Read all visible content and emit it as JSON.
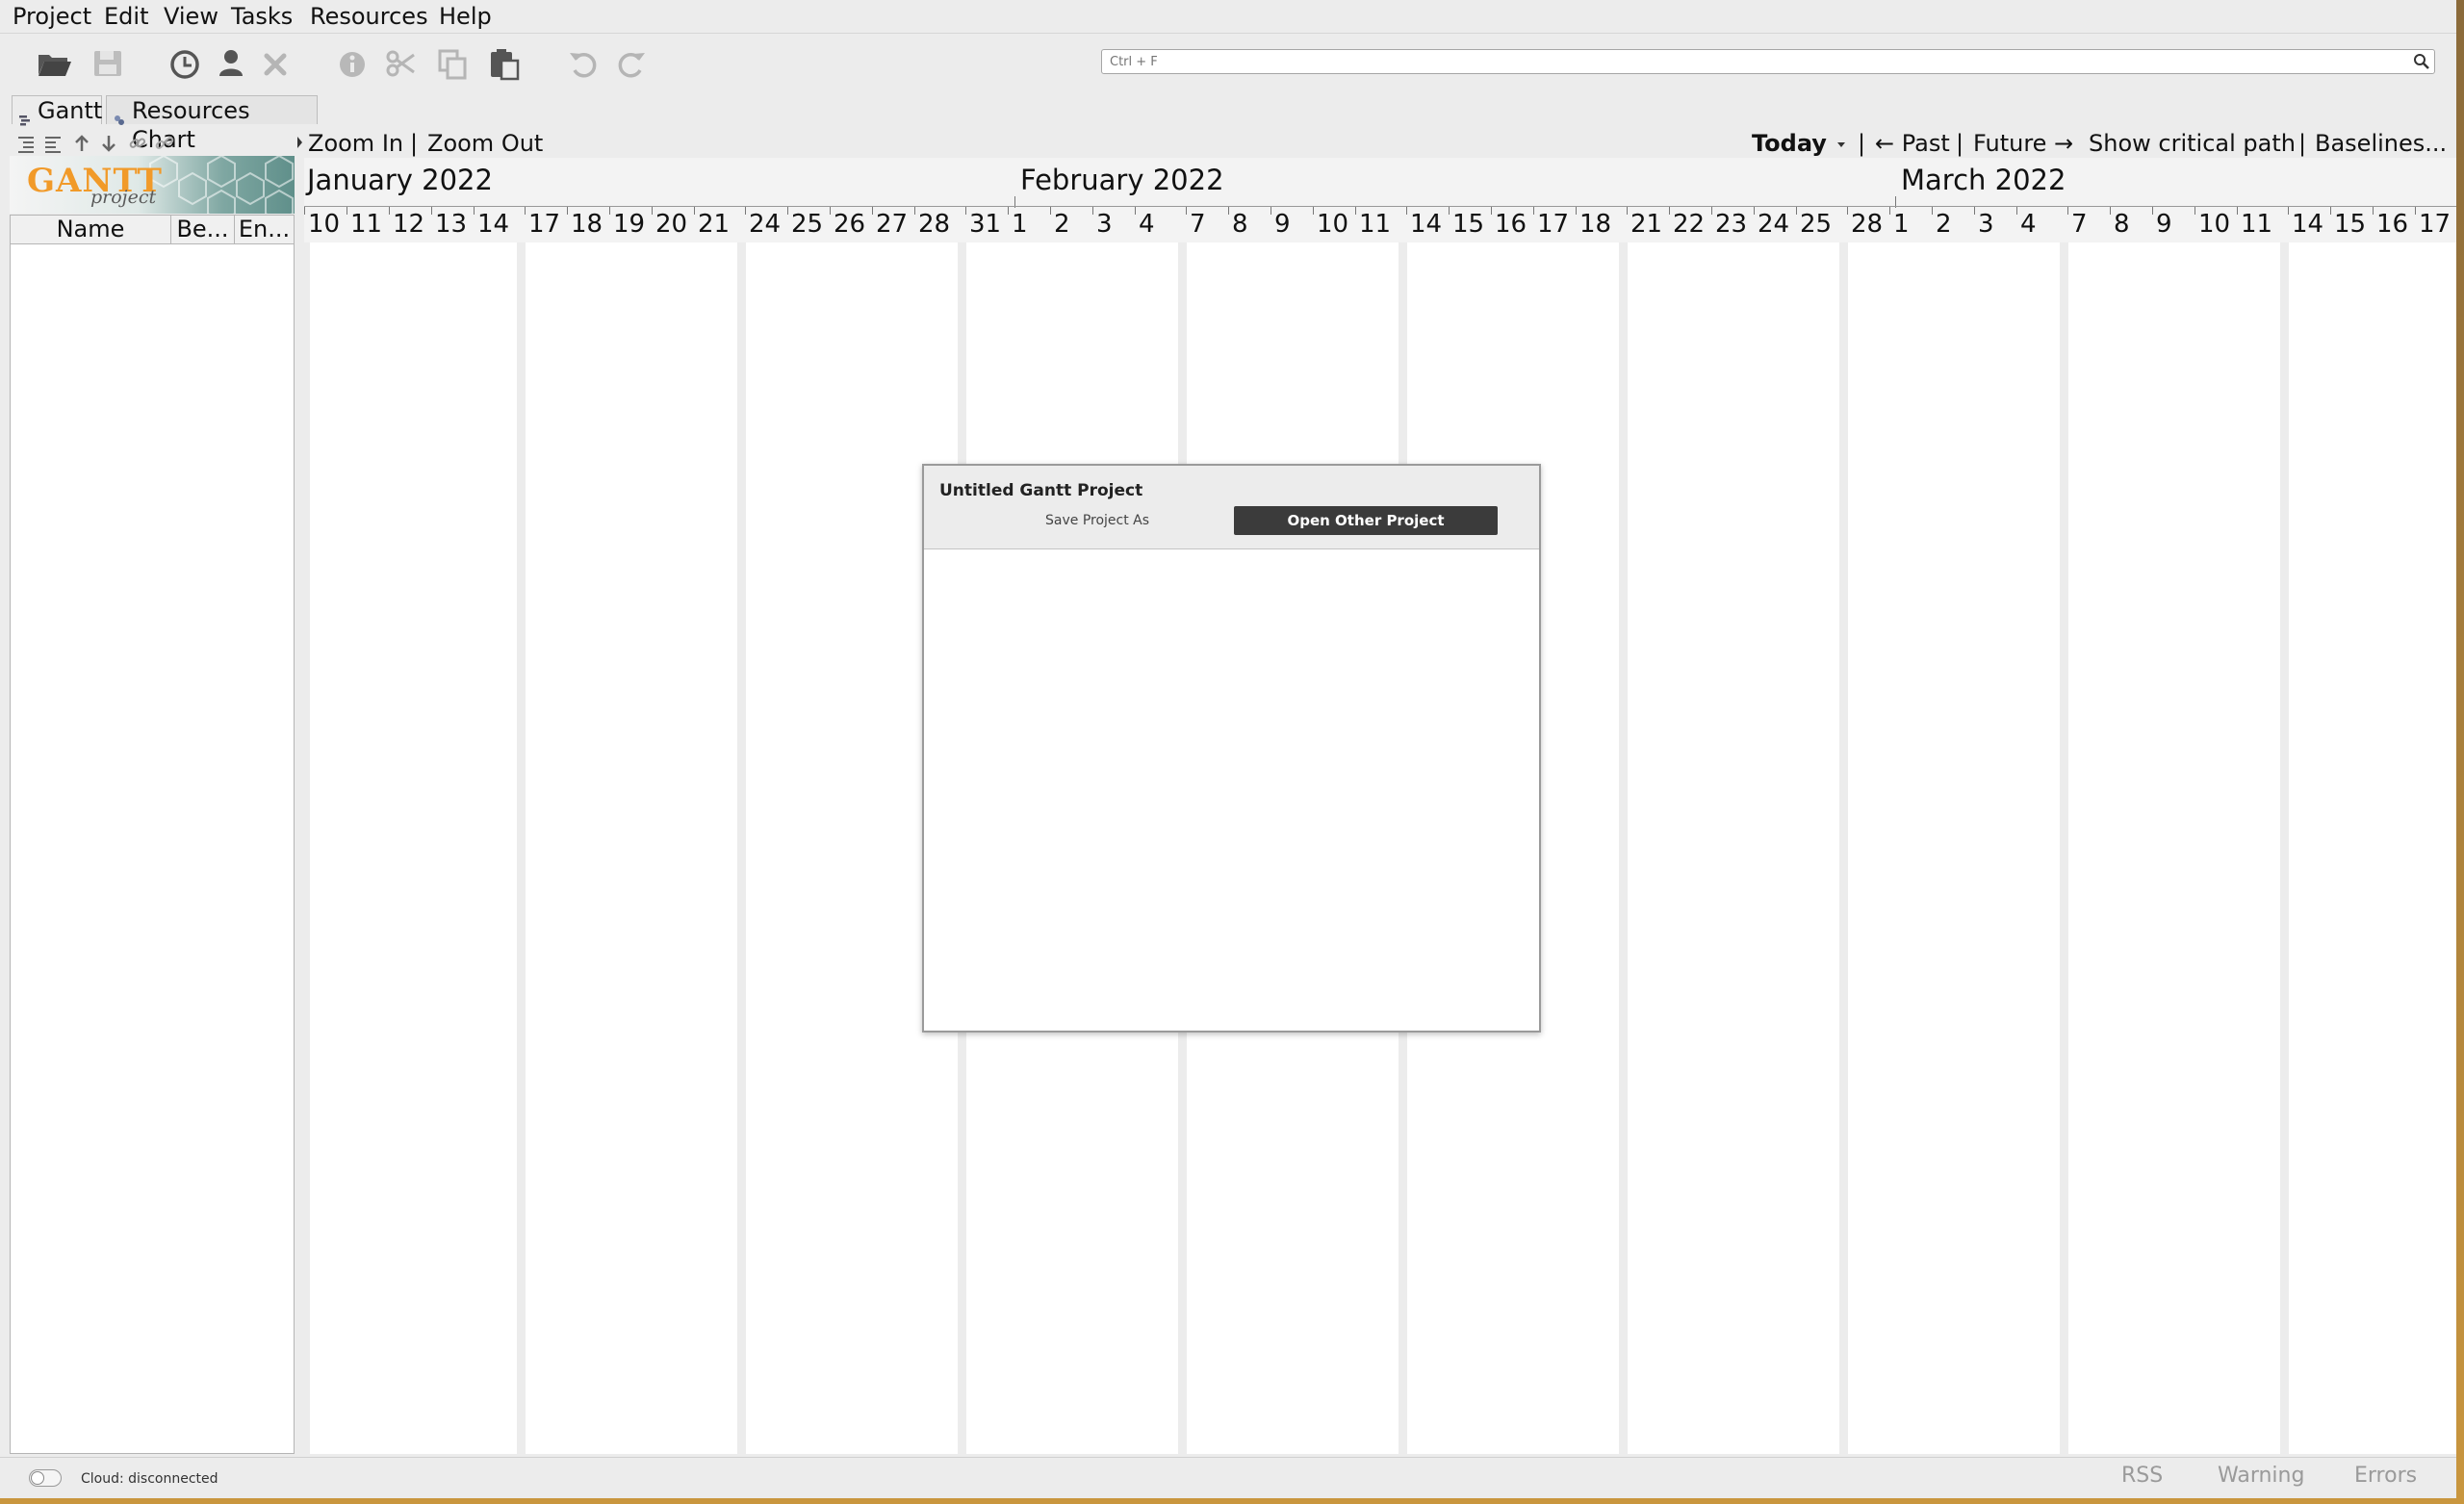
{
  "menu": {
    "items": [
      {
        "label": "Project"
      },
      {
        "label": "Edit"
      },
      {
        "label": "View"
      },
      {
        "label": "Tasks"
      },
      {
        "label": "Resources"
      },
      {
        "label": "Help"
      }
    ]
  },
  "toolbar": {
    "icons": [
      "open-folder-icon",
      "save-icon",
      "history-icon",
      "user-icon",
      "delete-icon",
      "info-icon",
      "cut-icon",
      "copy-icon",
      "paste-icon",
      "undo-icon",
      "redo-icon"
    ],
    "search_placeholder": "Ctrl + F"
  },
  "tabs": [
    {
      "label": "Gantt",
      "active": true
    },
    {
      "label": "Resources Chart",
      "active": false
    }
  ],
  "logo": {
    "text": "GANTT",
    "sub": "project"
  },
  "task_table": {
    "columns": [
      "Name",
      "Be...",
      "En..."
    ]
  },
  "chart_controls": {
    "zoom_in": "Zoom In",
    "sep1": "|",
    "zoom_out": "Zoom Out",
    "today": "Today",
    "sep2": "|",
    "past": "← Past",
    "sep3": "|",
    "future": "Future →",
    "critical_path": "Show critical path",
    "sep4": "|",
    "baselines": "Baselines..."
  },
  "timeline": {
    "months": [
      "January 2022",
      "February 2022",
      "March 2022"
    ],
    "days": [
      "10",
      "11",
      "12",
      "13",
      "14",
      "17",
      "18",
      "19",
      "20",
      "21",
      "24",
      "25",
      "26",
      "27",
      "28",
      "31",
      "1",
      "2",
      "3",
      "4",
      "7",
      "8",
      "9",
      "10",
      "11",
      "14",
      "15",
      "16",
      "17",
      "18",
      "21",
      "22",
      "23",
      "24",
      "25",
      "28",
      "1",
      "2",
      "3",
      "4",
      "7",
      "8",
      "9",
      "10",
      "11",
      "14",
      "15",
      "16",
      "17"
    ]
  },
  "dialog": {
    "title": "Untitled Gantt Project",
    "save_as": "Save Project As",
    "open_other": "Open Other Project"
  },
  "statusbar": {
    "cloud": "Cloud: disconnected",
    "rss": "RSS",
    "warning": "Warning",
    "errors": "Errors"
  }
}
